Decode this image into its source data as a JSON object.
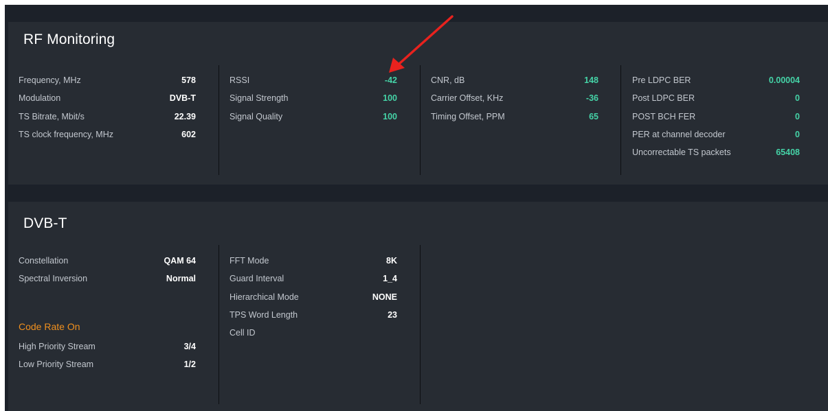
{
  "rf": {
    "title": "RF Monitoring",
    "col1": [
      {
        "label": "Frequency, MHz",
        "value": "578"
      },
      {
        "label": "Modulation",
        "value": "DVB-T"
      },
      {
        "label": "TS Bitrate, Mbit/s",
        "value": "22.39"
      },
      {
        "label": "TS clock frequency, MHz",
        "value": "602"
      }
    ],
    "col2": [
      {
        "label": "RSSI",
        "value": "-42"
      },
      {
        "label": "Signal Strength",
        "value": "100"
      },
      {
        "label": "Signal Quality",
        "value": "100"
      }
    ],
    "col3": [
      {
        "label": "CNR, dB",
        "value": "148"
      },
      {
        "label": "Carrier Offset, KHz",
        "value": "-36"
      },
      {
        "label": "Timing Offset, PPM",
        "value": "65"
      }
    ],
    "col4": [
      {
        "label": "Pre LDPC BER",
        "value": "0.00004"
      },
      {
        "label": "Post LDPC BER",
        "value": "0"
      },
      {
        "label": "POST BCH FER",
        "value": "0"
      },
      {
        "label": "PER at channel decoder",
        "value": "0"
      },
      {
        "label": "Uncorrectable TS packets",
        "value": "65408"
      }
    ]
  },
  "dvbt": {
    "title": "DVB-T",
    "col1": [
      {
        "label": "Constellation",
        "value": "QAM 64"
      },
      {
        "label": "Spectral Inversion",
        "value": "Normal"
      }
    ],
    "code_rate_heading": "Code Rate On",
    "code_rate": [
      {
        "label": "High Priority Stream",
        "value": "3/4"
      },
      {
        "label": "Low Priority Stream",
        "value": "1/2"
      }
    ],
    "col2": [
      {
        "label": "FFT Mode",
        "value": "8K"
      },
      {
        "label": "Guard Interval",
        "value": "1_4"
      },
      {
        "label": "Hierarchical Mode",
        "value": "NONE"
      },
      {
        "label": "TPS Word Length",
        "value": "23"
      },
      {
        "label": "Cell ID",
        "value": ""
      }
    ]
  },
  "annotation": {
    "color": "#e8221e",
    "points_to": "rssi-value"
  },
  "colors": {
    "background": "#1c2129",
    "panel": "#272c33",
    "value_green": "#45d3a7",
    "accent_orange": "#f0901e"
  }
}
